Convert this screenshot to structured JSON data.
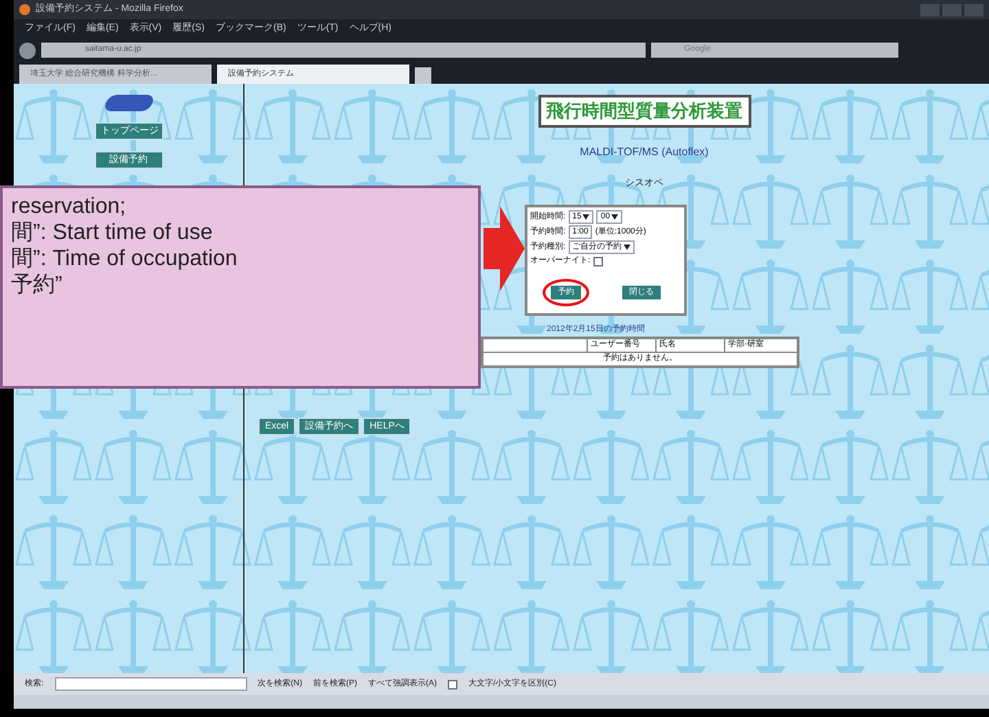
{
  "browser": {
    "title": "設備予約システム - Mozilla Firefox",
    "menu": [
      "ファイル(F)",
      "編集(E)",
      "表示(V)",
      "履歴(S)",
      "ブックマーク(B)",
      "ツール(T)",
      "ヘルプ(H)"
    ],
    "address": "saitama-u.ac.jp",
    "search_placeholder": "Google",
    "tabs": [
      {
        "label": "埼玉大学 総合研究機構 科学分析...",
        "selected": false
      },
      {
        "label": "設備予約システム",
        "selected": true
      }
    ]
  },
  "left_frame": {
    "buttons": [
      "トップページ",
      "設備予約"
    ]
  },
  "page": {
    "title": "飛行時間型質量分析装置",
    "subtitle": "MALDI-TOF/MS (Autoflex)",
    "operator": "シスオペ",
    "form": {
      "rows": [
        {
          "kind": "select",
          "label": "開始時間:",
          "value": "15",
          "value2": "00"
        },
        {
          "kind": "text",
          "label": "予約時間:",
          "value": "1:00",
          "note": "(単位:1000分)"
        },
        {
          "kind": "select",
          "label": "予約種別:",
          "value": "ご自分の予約"
        },
        {
          "kind": "checkbox",
          "label": "オーバーナイト:",
          "checked": false
        }
      ],
      "buttons": [
        {
          "label": "予約",
          "circled": true
        },
        {
          "label": "閉じる",
          "circled": false
        }
      ]
    },
    "schedule_title": "2012年2月15日の予約時間",
    "table": {
      "columns": [
        "ユーザー番号",
        "氏名",
        "学部·研室"
      ],
      "rows": [
        "予約はありません。"
      ]
    },
    "bottom_buttons": [
      "Excel",
      "設備予約へ",
      "HELPへ"
    ]
  },
  "find_bar": {
    "label": "検索:",
    "next": "次を検索(N)",
    "prev": "前を検索(P)",
    "highlight": "すべて強調表示(A)",
    "match_case": "大文字/小文字を区別(C)",
    "match_case_checked": false
  },
  "callout": {
    "lines": [
      "reservation;",
      "間”: Start time of use",
      "間”: Time of occupation",
      "予約”"
    ]
  }
}
